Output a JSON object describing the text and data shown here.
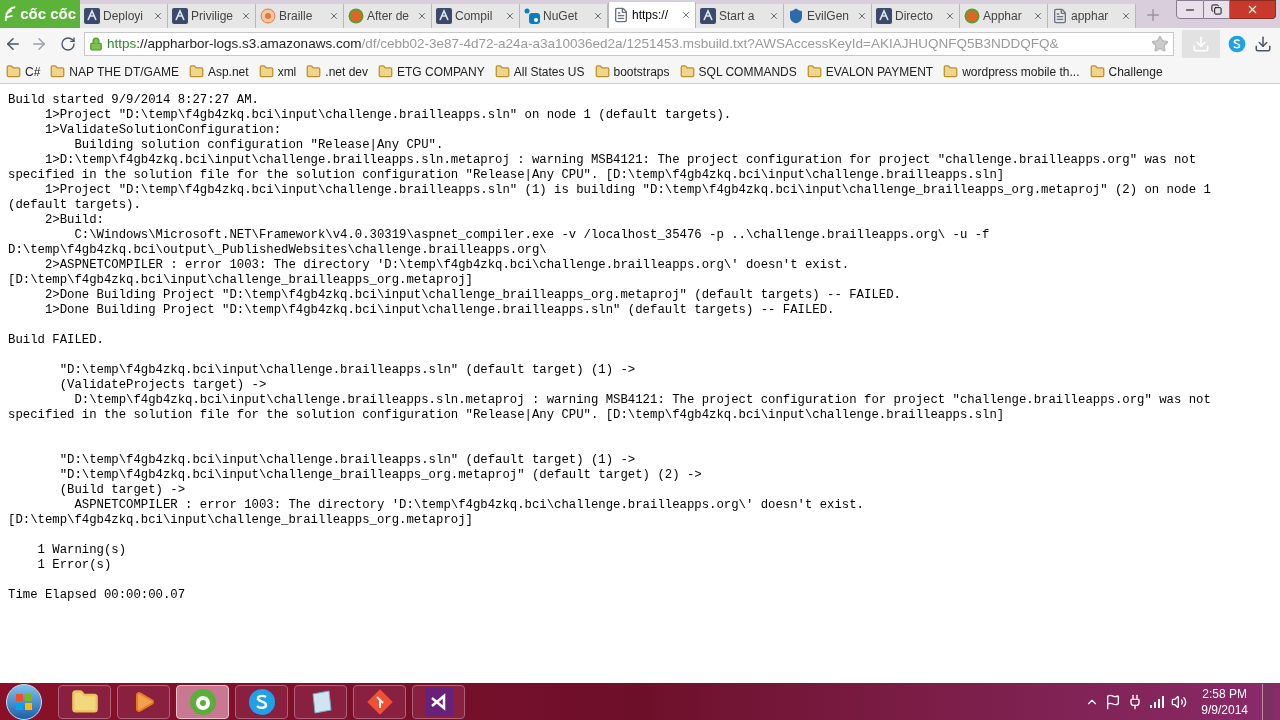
{
  "browser": {
    "logo": "cốc cốc"
  },
  "tabs": [
    {
      "title": "Deployi",
      "kind": "harbor",
      "selected": false
    },
    {
      "title": "Privilige",
      "kind": "harbor",
      "selected": false
    },
    {
      "title": "Braille",
      "kind": "braille",
      "selected": false
    },
    {
      "title": "After de",
      "kind": "cc",
      "selected": false
    },
    {
      "title": "Compil",
      "kind": "harbor",
      "selected": false
    },
    {
      "title": "NuGet",
      "kind": "nuget",
      "selected": false
    },
    {
      "title": "https://",
      "kind": "page",
      "selected": true
    },
    {
      "title": "Start a",
      "kind": "harbor",
      "selected": false
    },
    {
      "title": "EvilGen",
      "kind": "shield",
      "selected": false
    },
    {
      "title": "Directo",
      "kind": "harbor",
      "selected": false
    },
    {
      "title": "Apphar",
      "kind": "cc",
      "selected": false
    },
    {
      "title": "apphar",
      "kind": "page",
      "selected": false
    }
  ],
  "address": {
    "scheme": "https",
    "host": "://appharbor-logs.s3.amazonaws.com",
    "path": "/df/cebb02-3e87-4d72-a24a-a3a10036ed2a/1251453.msbuild.txt?AWSAccessKeyId=AKIAJHUQNFQ5B3NDDQFQ&"
  },
  "bookmarks": [
    "C#",
    "NAP THE DT/GAME",
    "Asp.net",
    "xml",
    ".net dev",
    "ETG COMPANY",
    "All States US",
    "bootstraps",
    "SQL COMMANDS",
    "EVALON PAYMENT",
    "wordpress mobile th...",
    "Challenge"
  ],
  "log": [
    {
      "kind": "text",
      "text": "Build started 9/9/2014 8:27:27 AM."
    },
    {
      "kind": "text",
      "text": "     1>Project \"D:\\temp\\f4gb4zkq.bci\\input\\challenge.brailleapps.sln\" on node 1 (default targets)."
    },
    {
      "kind": "text",
      "text": "     1>ValidateSolutionConfiguration:"
    },
    {
      "kind": "text",
      "text": "         Building solution configuration \"Release|Any CPU\"."
    },
    {
      "kind": "text",
      "text": "     1>D:\\temp\\f4gb4zkq.bci\\input\\challenge.brailleapps.sln.metaproj : warning MSB4121: The project configuration for project \"challenge.brailleapps.org\" was not"
    },
    {
      "kind": "text",
      "text": "specified in the solution file for the solution configuration \"Release|Any CPU\". [D:\\temp\\f4gb4zkq.bci\\input\\challenge.brailleapps.sln]"
    },
    {
      "kind": "text",
      "text": "     1>Project \"D:\\temp\\f4gb4zkq.bci\\input\\challenge.brailleapps.sln\" (1) is building \"D:\\temp\\f4gb4zkq.bci\\input\\challenge_brailleapps_org.metaproj\" (2) on node 1"
    },
    {
      "kind": "text",
      "text": "(default targets)."
    },
    {
      "kind": "text",
      "text": "     2>Build:"
    },
    {
      "kind": "text",
      "text": "         C:\\Windows\\Microsoft.NET\\Framework\\v4.0.30319\\aspnet_compiler.exe -v /localhost_35476 -p ..\\challenge.brailleapps.org\\ -u -f"
    },
    {
      "kind": "text",
      "text": "D:\\temp\\f4gb4zkq.bci\\output\\_PublishedWebsites\\challenge.brailleapps.org\\"
    },
    {
      "kind": "text",
      "text": "     2>ASPNETCOMPILER : error 1003: The directory 'D:\\temp\\f4gb4zkq.bci\\challenge.brailleapps.org\\' doesn't exist."
    },
    {
      "kind": "text",
      "text": "[D:\\temp\\f4gb4zkq.bci\\input\\challenge_brailleapps_org.metaproj]"
    },
    {
      "kind": "text",
      "text": "     2>Done Building Project \"D:\\temp\\f4gb4zkq.bci\\input\\challenge_brailleapps_org.metaproj\" (default targets) -- FAILED."
    },
    {
      "kind": "text",
      "text": "     1>Done Building Project \"D:\\temp\\f4gb4zkq.bci\\input\\challenge.brailleapps.sln\" (default targets) -- FAILED."
    },
    {
      "kind": "blank"
    },
    {
      "kind": "text",
      "text": "Build FAILED."
    },
    {
      "kind": "blank"
    },
    {
      "kind": "text",
      "text": "       \"D:\\temp\\f4gb4zkq.bci\\input\\challenge.brailleapps.sln\" (default target) (1) ->"
    },
    {
      "kind": "text",
      "text": "       (ValidateProjects target) ->"
    },
    {
      "kind": "text",
      "text": "         D:\\temp\\f4gb4zkq.bci\\input\\challenge.brailleapps.sln.metaproj : warning MSB4121: The project configuration for project \"challenge.brailleapps.org\" was not"
    },
    {
      "kind": "text",
      "text": "specified in the solution file for the solution configuration \"Release|Any CPU\". [D:\\temp\\f4gb4zkq.bci\\input\\challenge.brailleapps.sln]"
    },
    {
      "kind": "blank"
    },
    {
      "kind": "blank"
    },
    {
      "kind": "text",
      "text": "       \"D:\\temp\\f4gb4zkq.bci\\input\\challenge.brailleapps.sln\" (default target) (1) ->"
    },
    {
      "kind": "text",
      "text": "       \"D:\\temp\\f4gb4zkq.bci\\input\\challenge_brailleapps_org.metaproj\" (default target) (2) ->"
    },
    {
      "kind": "text",
      "text": "       (Build target) ->"
    },
    {
      "kind": "text",
      "text": "         ASPNETCOMPILER : error 1003: The directory 'D:\\temp\\f4gb4zkq.bci\\challenge.brailleapps.org\\' doesn't exist."
    },
    {
      "kind": "text",
      "text": "[D:\\temp\\f4gb4zkq.bci\\input\\challenge_brailleapps_org.metaproj]"
    },
    {
      "kind": "blank"
    },
    {
      "kind": "text",
      "text": "    1 Warning(s)"
    },
    {
      "kind": "text",
      "text": "    1 Error(s)"
    },
    {
      "kind": "blank"
    },
    {
      "kind": "text",
      "text": "Time Elapsed 00:00:00.07"
    }
  ],
  "taskbar": {
    "apps": [
      {
        "kind": "folder",
        "selected": false
      },
      {
        "kind": "media",
        "selected": false
      },
      {
        "kind": "browser",
        "selected": true
      },
      {
        "kind": "skype",
        "selected": false
      },
      {
        "kind": "notepad",
        "selected": false
      },
      {
        "kind": "git",
        "selected": false
      },
      {
        "kind": "vs",
        "selected": false
      }
    ],
    "time": "2:58 PM",
    "date": "9/9/2014"
  }
}
